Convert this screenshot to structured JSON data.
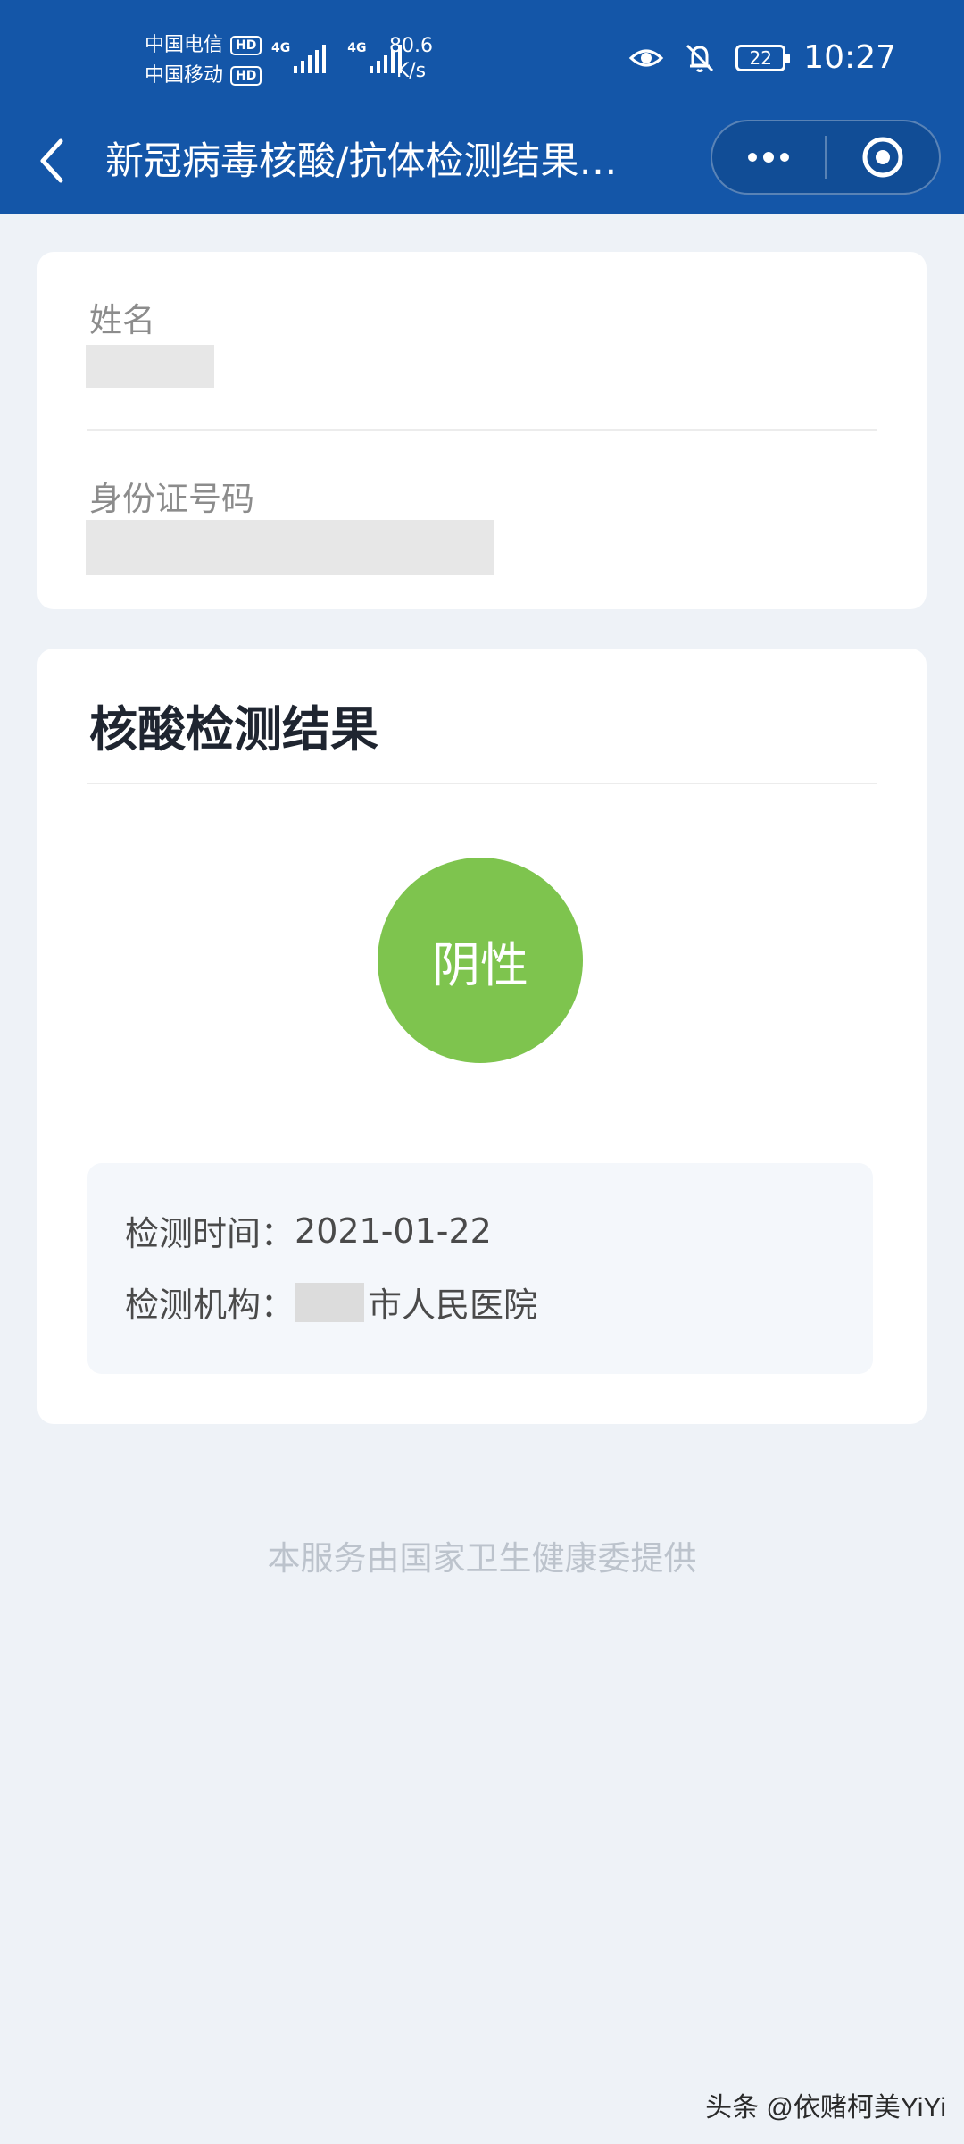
{
  "status_bar": {
    "carrier_1": "中国电信",
    "carrier_2": "中国移动",
    "hd_label": "HD",
    "network_1": "4G",
    "network_2": "4G",
    "net_speed_value": "80.6",
    "net_speed_unit": "K/s",
    "battery_level": "22",
    "time": "10:27"
  },
  "nav": {
    "title": "新冠病毒核酸/抗体检测结果查询",
    "back_icon": "chevron-left-icon",
    "more_icon": "more-dots-icon",
    "close_icon": "target-close-icon"
  },
  "identity": {
    "name_label": "姓名",
    "id_label": "身份证号码"
  },
  "result": {
    "title": "核酸检测结果",
    "status": "阴性",
    "status_color": "#7ec44e",
    "test_time_label": "检测时间：",
    "test_time_value": "2021-01-22",
    "institution_label": "检测机构：",
    "institution_value": "市人民医院"
  },
  "footer": {
    "note": "本服务由国家卫生健康委提供"
  },
  "watermark": "头条 @依赌柯美YiYi",
  "colors": {
    "header_bg": "#1456a8",
    "page_bg": "#eef2f7",
    "card_bg": "#ffffff"
  }
}
